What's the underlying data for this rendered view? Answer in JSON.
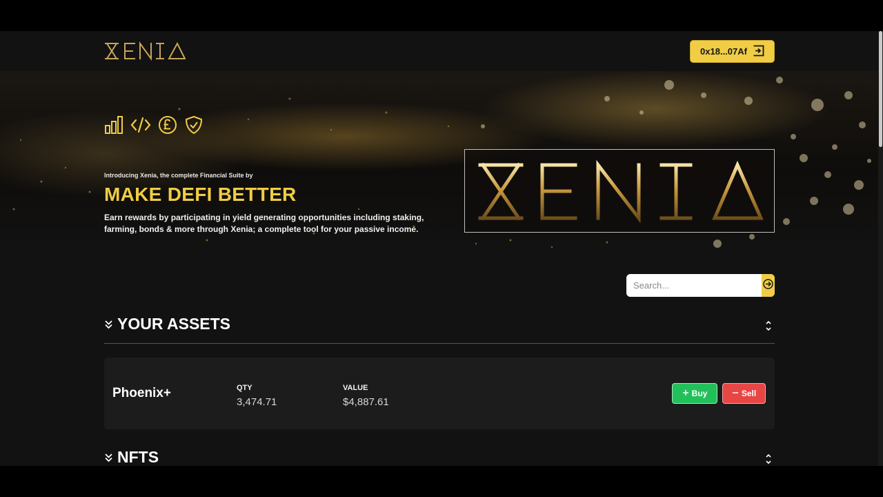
{
  "header": {
    "logo_text": "XENIA",
    "wallet_label": "0x18...07Af",
    "wallet_icon": "sign-out-icon"
  },
  "hero": {
    "icons": [
      "bar-chart-icon",
      "code-icon",
      "pound-coin-icon",
      "shield-check-icon"
    ],
    "intro": "Introducing Xenia, the complete Financial Suite by",
    "title": "MAKE DEFI BETTER",
    "description": "Earn rewards by participating in yield generating opportunities including staking, farming, bonds & more through Xenia; a complete tool for your passive income.",
    "logo_text": "XENIA"
  },
  "search": {
    "placeholder": "Search...",
    "value": ""
  },
  "assets_section": {
    "title": "YOUR ASSETS",
    "items": [
      {
        "name": "Phoenix+",
        "qty_label": "QTY",
        "qty": "3,474.71",
        "value_label": "VALUE",
        "value": "$4,887.61",
        "buy_label": "Buy",
        "sell_label": "Sell"
      }
    ]
  },
  "nfts_section": {
    "title": "NFTS"
  },
  "colors": {
    "accent": "#f0cd45",
    "background": "#121212",
    "card": "#1c1c1c",
    "buy": "#22c05a",
    "sell": "#e84545"
  }
}
